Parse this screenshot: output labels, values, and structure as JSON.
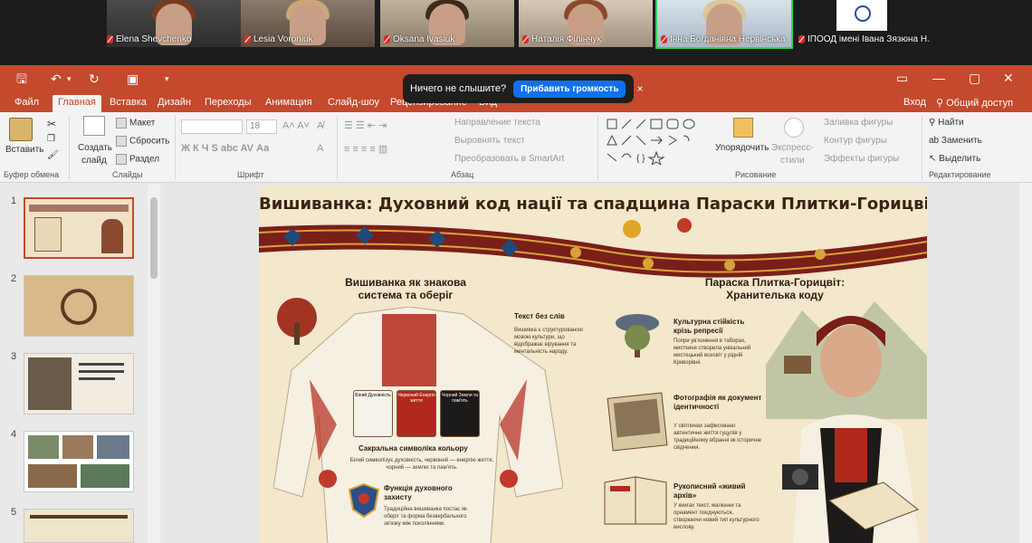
{
  "zoom": {
    "participants": [
      {
        "name": "Elena Shevchenko",
        "active": false
      },
      {
        "name": "Lesia Voroniuk",
        "active": false
      },
      {
        "name": "Oksana Ivasiuk",
        "active": false
      },
      {
        "name": "Наталія Філінчук",
        "active": false
      },
      {
        "name": "Інна Богданівна Нервінська",
        "active": true
      },
      {
        "name": "ІПООД імені Івана Зязюна Н...",
        "active": false
      }
    ],
    "notification": {
      "text": "Ничего не слышите?",
      "button": "Прибавить громкость",
      "close": "×"
    }
  },
  "ribbon": {
    "tabs": [
      "Файл",
      "Главная",
      "Вставка",
      "Дизайн",
      "Переходы",
      "Анимация",
      "Слайд-шоу",
      "Рецензирование",
      "Вид"
    ],
    "active_tab": "Главная",
    "login": "Вход",
    "share": "Общий доступ",
    "clipboard": {
      "paste": "Вставить",
      "group": "Буфер обмена"
    },
    "slides": {
      "new": "Создать",
      "new2": "слайд",
      "layout": "Макет",
      "reset": "Сбросить",
      "section": "Раздел",
      "group": "Слайды"
    },
    "font": {
      "size": "18",
      "buttons": "Ж К Ч S abc AV Аа",
      "group": "Шрифт"
    },
    "paragraph": {
      "dir": "Направление текста",
      "align": "Выровнять текст",
      "smartart": "Преобразовать в SmartArt",
      "group": "Абзац"
    },
    "drawing": {
      "arrange": "Упорядочить",
      "styles": "Экспресс-",
      "styles2": "стили",
      "fill": "Заливка фигуры",
      "outline": "Контур фигуры",
      "effects": "Эффекты фигуры",
      "group": "Рисование"
    },
    "editing": {
      "find": "Найти",
      "replace": "Заменить",
      "select": "Выделить",
      "group": "Редактирование"
    }
  },
  "thumbnails": [
    {
      "number": "1",
      "selected": true
    },
    {
      "number": "2",
      "selected": false
    },
    {
      "number": "3",
      "selected": false
    },
    {
      "number": "4",
      "selected": false
    },
    {
      "number": "5",
      "selected": false
    }
  ],
  "slide": {
    "title": "Вишиванка: Духовний код нації та спадщина Параски Плитки-Горицвіт",
    "left_heading": "Вишиванка як знакова система та оберіг",
    "right_heading": "Параска Плитка-Горицвіт: Хранителька коду",
    "text_no_words": "Текст без слів",
    "text_no_words_body": "Вишивка є структурованою мовою культури, що відображає вірування та ментальність народу.",
    "swatch_white": "Білий Духовність",
    "swatch_red": "Червоний Енергія життя",
    "swatch_black": "Чорний Земля та пам'ять",
    "sacred_colors": "Сакральна символіка кольору",
    "sacred_colors_body": "Білий символізує духовність, червоний — енергію життя, чорний — землю та пам'ять.",
    "protection": "Функція духовного захисту",
    "protection_body": "Традиційна вишиванка постає як оберіг та форма безвербального зв'язку між поколіннями.",
    "resilience": "Культурна стійкість крізь репресії",
    "resilience_body": "Попри ув'язнення в таборах, мисткиня створила унікальний мистецький всесвіт у рідній Криворівні.",
    "photo": "Фотографія як документ ідентичності",
    "photo_body": "У світлинах зафіксовано автентичне життя гуцулів у традиційному вбранні як історичне свідчення.",
    "archive": "Рукописний «живий архів»",
    "archive_body": "У книгах текст, малюнки та орнамент поєднуються, створюючи новий тип культурного вислову."
  }
}
